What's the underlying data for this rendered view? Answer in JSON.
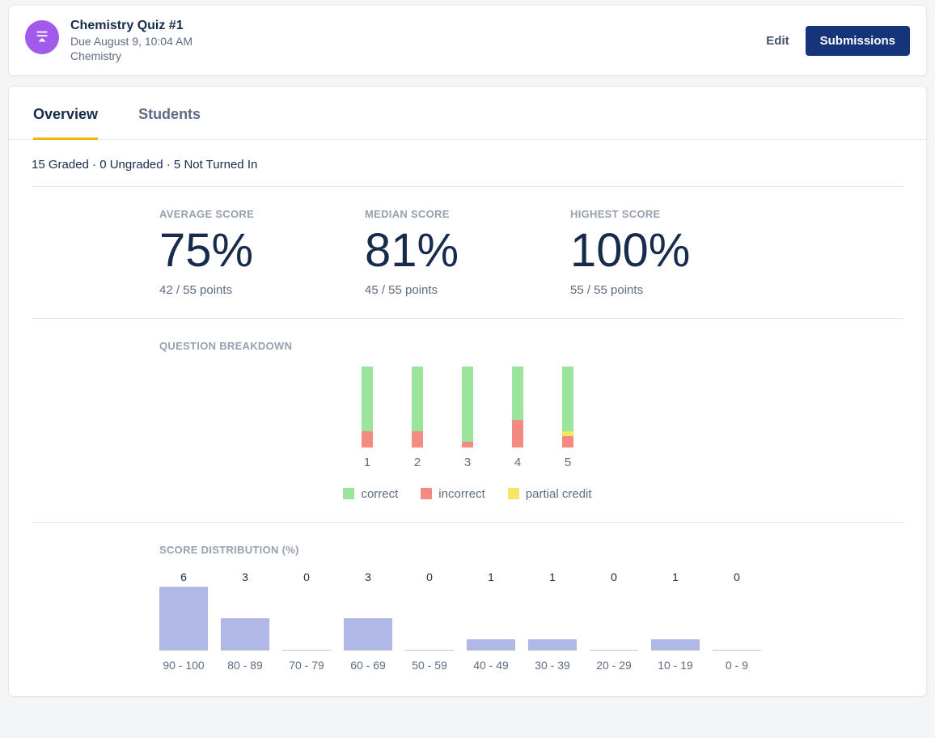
{
  "header": {
    "title": "Chemistry Quiz #1",
    "due": "Due August 9, 10:04 AM",
    "subject": "Chemistry",
    "edit_label": "Edit",
    "submissions_label": "Submissions"
  },
  "tabs": {
    "overview": "Overview",
    "students": "Students"
  },
  "status_line": "15 Graded · 0 Ungraded · 5 Not Turned In",
  "stats": {
    "average": {
      "label": "AVERAGE SCORE",
      "value": "75%",
      "points": "42 / 55 points"
    },
    "median": {
      "label": "MEDIAN SCORE",
      "value": "81%",
      "points": "45 / 55 points"
    },
    "highest": {
      "label": "HIGHEST SCORE",
      "value": "100%",
      "points": "55 / 55 points"
    }
  },
  "question_breakdown": {
    "title": "QUESTION BREAKDOWN",
    "legend": {
      "correct": "correct",
      "incorrect": "incorrect",
      "partial": "partial credit"
    },
    "colors": {
      "correct": "#9be49b",
      "incorrect": "#f28b82",
      "partial": "#f5e663"
    }
  },
  "score_distribution": {
    "title": "SCORE DISTRIBUTION (%)",
    "bar_color": "#b0b8e8"
  },
  "chart_data": [
    {
      "name": "question_breakdown",
      "type": "bar",
      "stacked": true,
      "categories": [
        "1",
        "2",
        "3",
        "4",
        "5"
      ],
      "ylim": [
        0,
        15
      ],
      "series": [
        {
          "name": "correct",
          "values": [
            12,
            12,
            14,
            10,
            12
          ]
        },
        {
          "name": "partial",
          "values": [
            0,
            0,
            0,
            0,
            1
          ]
        },
        {
          "name": "incorrect",
          "values": [
            3,
            3,
            1,
            5,
            2
          ]
        }
      ],
      "legend": [
        "correct",
        "incorrect",
        "partial credit"
      ]
    },
    {
      "name": "score_distribution",
      "type": "bar",
      "categories": [
        "90 - 100",
        "80 - 89",
        "70 - 79",
        "60 - 69",
        "50 - 59",
        "40 - 49",
        "30 - 39",
        "20 - 29",
        "10 - 19",
        "0 - 9"
      ],
      "values": [
        6,
        3,
        0,
        3,
        0,
        1,
        1,
        0,
        1,
        0
      ],
      "ylim": [
        0,
        6
      ],
      "xlabel": "",
      "ylabel": ""
    }
  ]
}
